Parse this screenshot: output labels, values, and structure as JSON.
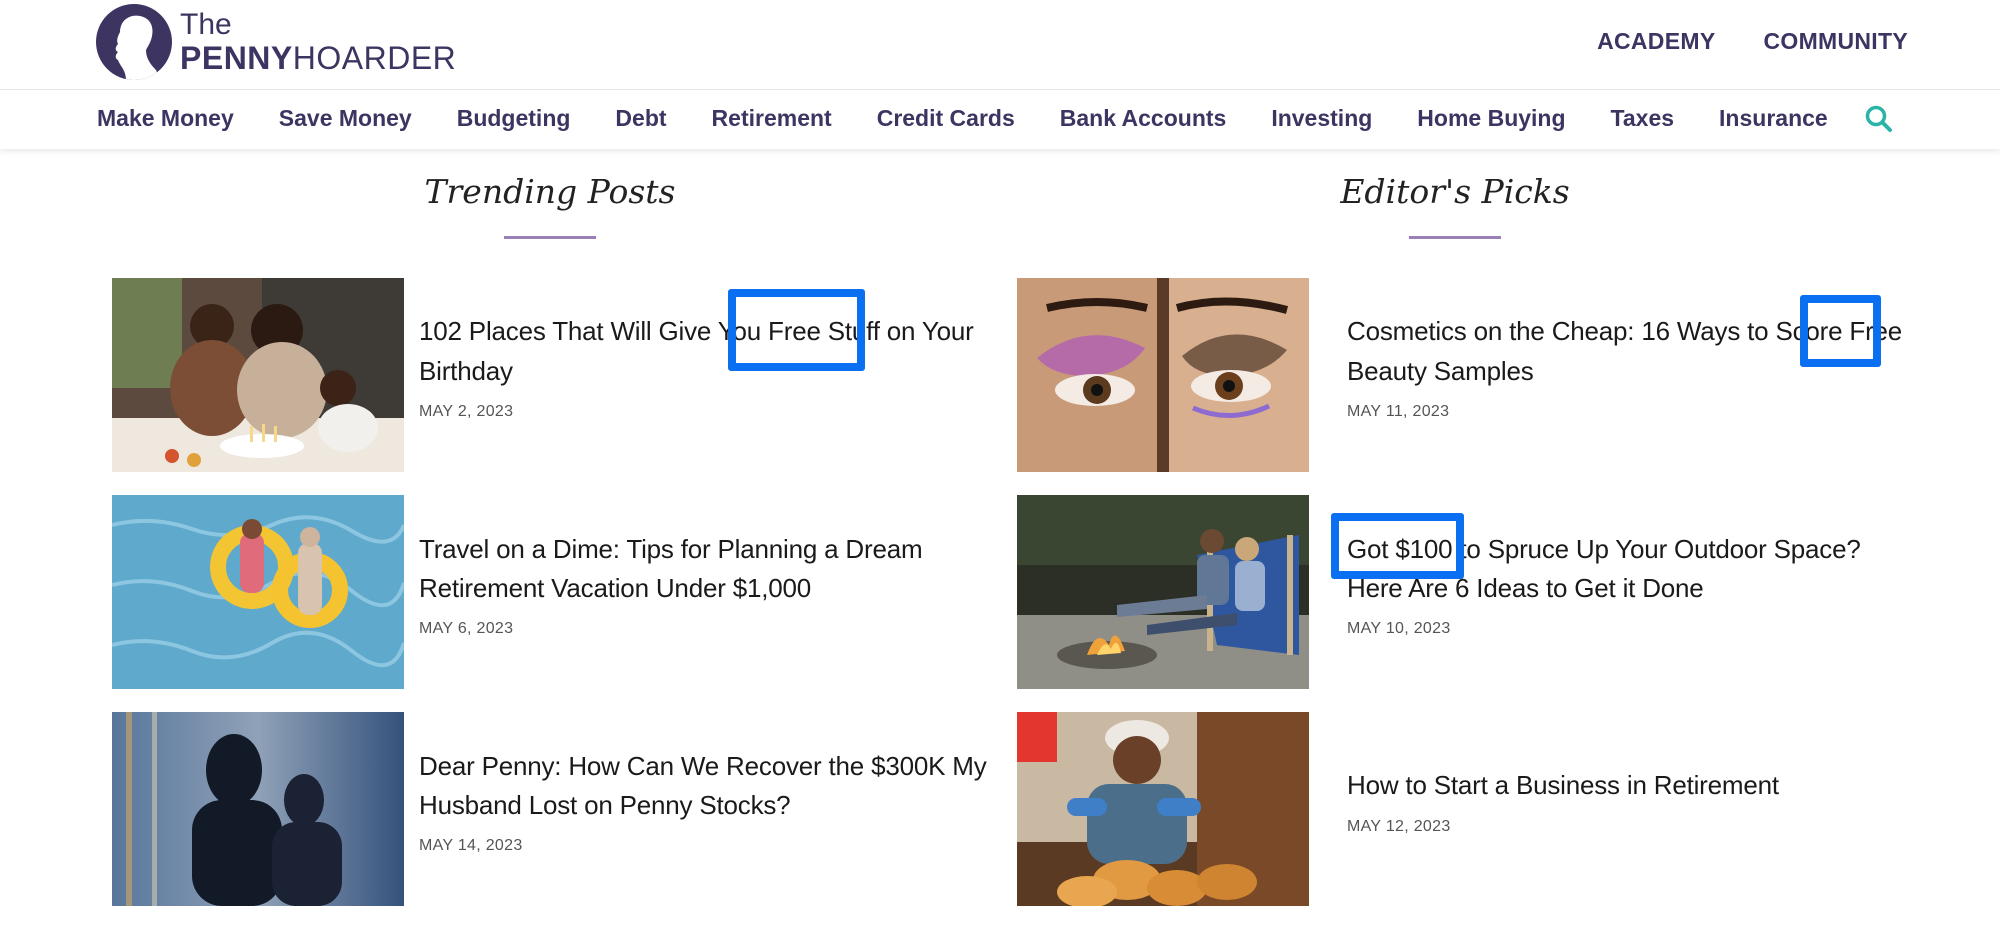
{
  "header": {
    "logo": {
      "the": "The",
      "penny": "PENNY",
      "hoarder": "HOARDER"
    },
    "top_links": [
      "ACADEMY",
      "COMMUNITY"
    ]
  },
  "nav": {
    "items": [
      "Make Money",
      "Save Money",
      "Budgeting",
      "Debt",
      "Retirement",
      "Credit Cards",
      "Bank Accounts",
      "Investing",
      "Home Buying",
      "Taxes",
      "Insurance"
    ],
    "search_icon": "search-icon"
  },
  "trending": {
    "title": "Trending Posts",
    "posts": [
      {
        "title_line1": "102 Places That Will Give You Free Stuff on Your",
        "title_line2": "Birthday",
        "date": "MAY 2, 2023"
      },
      {
        "title_line1": "Travel on a Dime: Tips for Planning a Dream",
        "title_line2": "Retirement Vacation Under $1,000",
        "date": "MAY 6, 2023"
      },
      {
        "title_line1": "Dear Penny: How Can We Recover the $300K My",
        "title_line2": "Husband Lost on Penny Stocks?",
        "date": "MAY 14, 2023"
      }
    ]
  },
  "editors": {
    "title": "Editor's Picks",
    "posts": [
      {
        "title_line1": "Cosmetics on the Cheap: 16 Ways to Score Free",
        "title_line2": "Beauty Samples",
        "date": "MAY 11, 2023"
      },
      {
        "title_line1": "Got $100 to Spruce Up Your Outdoor Space?",
        "title_line2": "Here Are 6 Ideas to Get it Done",
        "date": "MAY 10, 2023"
      },
      {
        "title_line1": "How to Start a Business in Retirement",
        "title_line2": "",
        "date": "MAY 12, 2023"
      }
    ]
  },
  "colors": {
    "brand": "#3d3461",
    "accent_teal": "#2bb3a8",
    "highlight": "#0a6ff0",
    "rule": "#9b7fb8"
  }
}
